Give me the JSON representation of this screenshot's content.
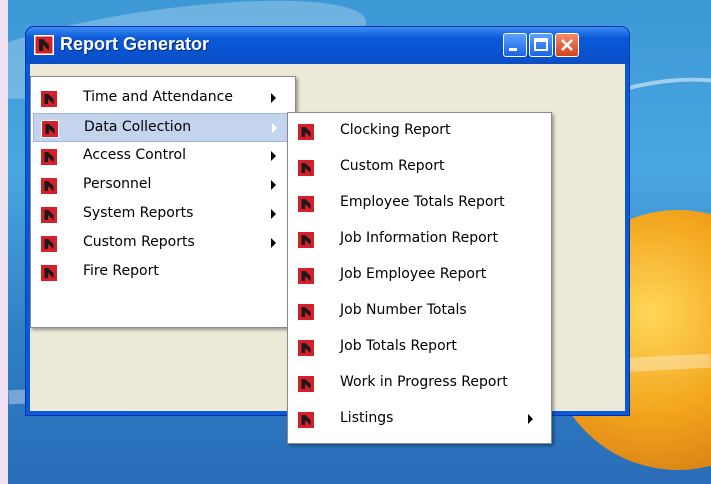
{
  "window": {
    "title": "Report Generator"
  },
  "menu": {
    "items": [
      {
        "label": "Time and Attendance",
        "submenu": true
      },
      {
        "label": "Data Collection",
        "submenu": true,
        "highlighted": true
      },
      {
        "label": "Access Control",
        "submenu": true
      },
      {
        "label": "Personnel",
        "submenu": true
      },
      {
        "label": "System Reports",
        "submenu": true
      },
      {
        "label": "Custom Reports",
        "submenu": true
      },
      {
        "label": "Fire Report",
        "submenu": false
      }
    ]
  },
  "submenu": {
    "items": [
      {
        "label": "Clocking Report"
      },
      {
        "label": "Custom Report"
      },
      {
        "label": "Employee Totals Report"
      },
      {
        "label": "Job Information Report"
      },
      {
        "label": "Job Employee Report"
      },
      {
        "label": "Job Number Totals"
      },
      {
        "label": "Job Totals Report"
      },
      {
        "label": "Work in Progress Report"
      },
      {
        "label": "Listings",
        "submenu": true
      }
    ]
  },
  "icons": {
    "report": "report-icon"
  },
  "colors": {
    "titlebar": "#0a5ad8",
    "menu_highlight": "#c3d4ec",
    "icon_red": "#d4202a"
  }
}
